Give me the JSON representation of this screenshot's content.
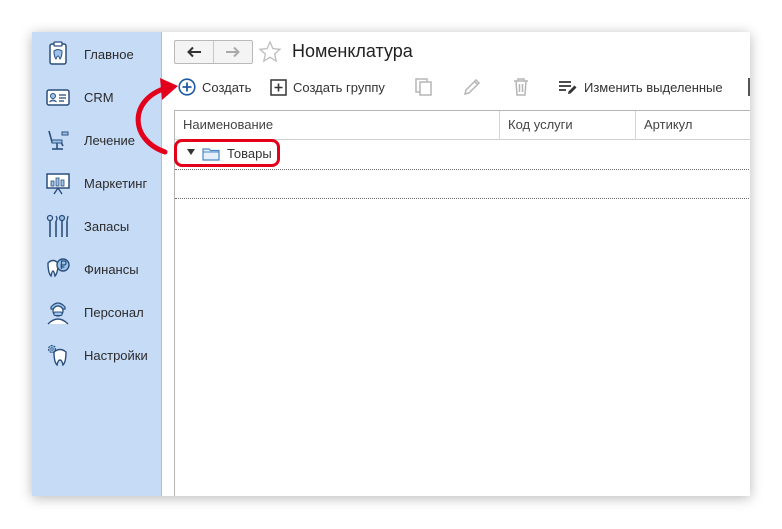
{
  "sidebar": {
    "items": [
      {
        "label": "Главное",
        "icon": "tooth-clipboard-icon"
      },
      {
        "label": "CRM",
        "icon": "id-card-icon"
      },
      {
        "label": "Лечение",
        "icon": "dental-chair-icon"
      },
      {
        "label": "Маркетинг",
        "icon": "presentation-chart-icon"
      },
      {
        "label": "Запасы",
        "icon": "dental-tools-icon"
      },
      {
        "label": "Финансы",
        "icon": "tooth-coin-icon"
      },
      {
        "label": "Персонал",
        "icon": "doctor-icon"
      },
      {
        "label": "Настройки",
        "icon": "tooth-gear-icon"
      }
    ]
  },
  "header": {
    "title": "Номенклатура"
  },
  "toolbar": {
    "create_label": "Создать",
    "create_group_label": "Создать группу",
    "edit_selected_label": "Изменить выделенные"
  },
  "table": {
    "columns": [
      "Наименование",
      "Код услуги",
      "Артикул"
    ],
    "group_row": {
      "label": "Товары"
    }
  },
  "colors": {
    "sidebar_bg": "#c6dbf6",
    "accent_blue": "#1f5aa6",
    "highlight_red": "#e3001b"
  }
}
